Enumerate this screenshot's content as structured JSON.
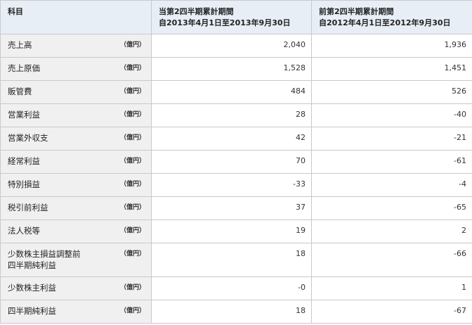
{
  "header": {
    "col_item": "科目",
    "current_title": "当第2四半期累計期間",
    "current_range": "自2013年4月1日至2013年9月30日",
    "prior_title": "前第2四半期累計期間",
    "prior_range": "自2012年4月1日至2012年9月30日"
  },
  "unit": "（億円）",
  "rows": [
    {
      "label": "売上高",
      "current": "2,040",
      "prior": "1,936"
    },
    {
      "label": "売上原価",
      "current": "1,528",
      "prior": "1,451"
    },
    {
      "label": "販管費",
      "current": "484",
      "prior": "526"
    },
    {
      "label": "営業利益",
      "current": "28",
      "prior": "-40"
    },
    {
      "label": "営業外収支",
      "current": "42",
      "prior": "-21"
    },
    {
      "label": "経常利益",
      "current": "70",
      "prior": "-61"
    },
    {
      "label": "特別損益",
      "current": "-33",
      "prior": "-4"
    },
    {
      "label": "税引前利益",
      "current": "37",
      "prior": "-65"
    },
    {
      "label": "法人税等",
      "current": "19",
      "prior": "2"
    },
    {
      "label": "少数株主損益調整前\n四半期純利益",
      "current": "18",
      "prior": "-66"
    },
    {
      "label": "少数株主利益",
      "current": "-0",
      "prior": "1"
    },
    {
      "label": "四半期純利益",
      "current": "18",
      "prior": "-67"
    }
  ]
}
